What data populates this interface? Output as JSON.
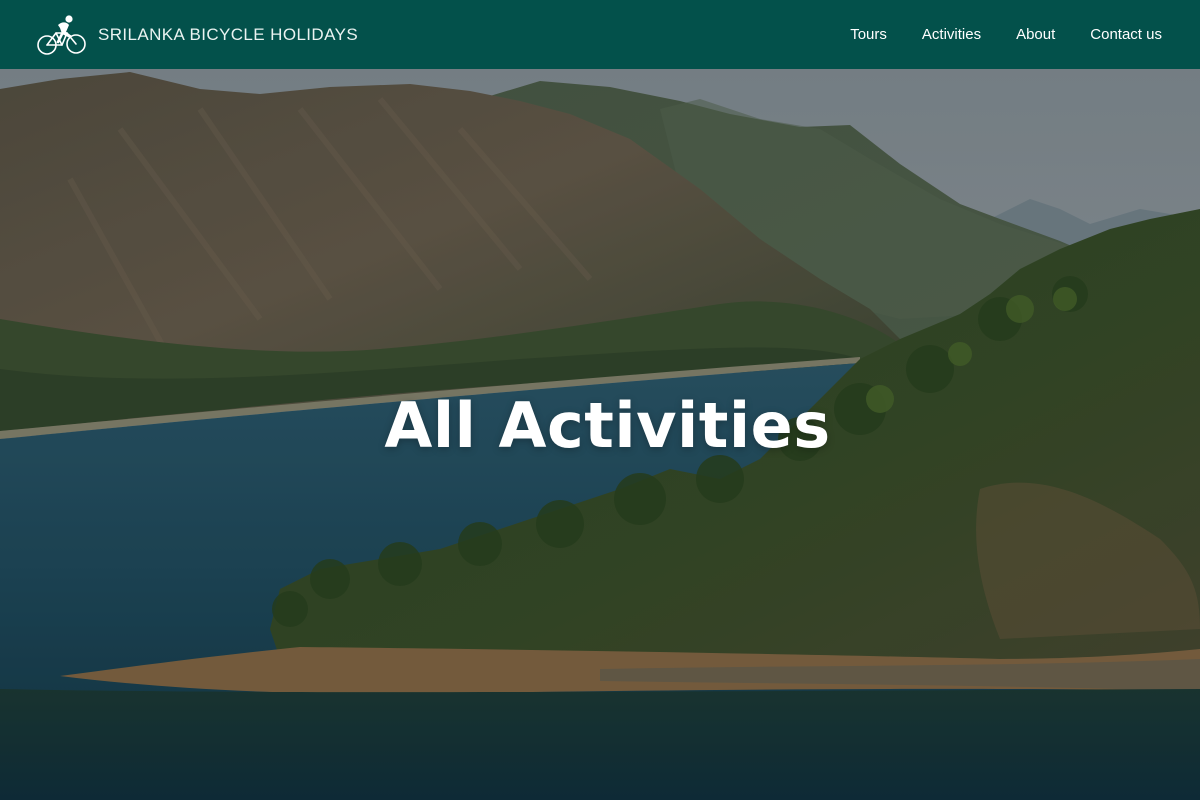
{
  "header": {
    "brand_name": "SRILANKA BICYCLE HOLIDAYS",
    "logo_icon": "cyclist-icon",
    "background_color": "#03514b",
    "nav": [
      {
        "label": "Tours"
      },
      {
        "label": "Activities"
      },
      {
        "label": "About"
      },
      {
        "label": "Contact us"
      }
    ]
  },
  "hero": {
    "title": "All Activities",
    "image": "mountain-lake-landscape"
  }
}
